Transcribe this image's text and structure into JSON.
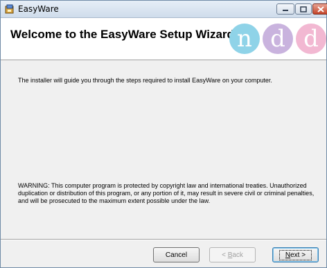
{
  "window": {
    "title": "EasyWare",
    "controls": {
      "minimize_icon": "minimize-icon",
      "maximize_icon": "maximize-icon",
      "close_icon": "close-icon"
    }
  },
  "header": {
    "title": "Welcome to the EasyWare Setup Wizard",
    "logo_letters": [
      "n",
      "d",
      "d"
    ],
    "logo_colors": [
      "#8fd3e8",
      "#c9b3de",
      "#f2b8d2"
    ]
  },
  "body": {
    "intro": "The installer will guide you through the steps required to install EasyWare on your computer.",
    "warning": "WARNING: This computer program is protected by copyright law and international treaties. Unauthorized duplication or distribution of this program, or any portion of it, may result in severe civil or criminal penalties, and will be prosecuted to the maximum extent possible under the law."
  },
  "buttons": {
    "cancel": "Cancel",
    "back_prefix": "< ",
    "back_mnemonic": "B",
    "back_rest": "ack",
    "next_mnemonic": "N",
    "next_rest": "ext >"
  }
}
